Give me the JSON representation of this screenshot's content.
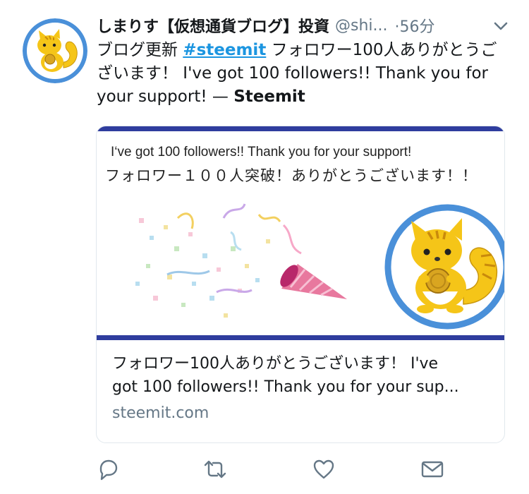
{
  "tweet": {
    "display_name": "しまりす【仮想通貨ブログ】投資",
    "handle": "@shi...",
    "time": "·56分",
    "text_prefix": "ブログ更新 ",
    "hashtag": "#steemit",
    "text_body": " フォロワー100人ありがとうございます！ I've got 100 followers!! Thank you for your support! — ",
    "text_source": "Steemit"
  },
  "card": {
    "image_line1": "I‘ve got 100 followers!! Thank you for your support!",
    "image_line2": "フォロワー１００人突破！ありがとうございます！！",
    "title_line1": "フォロワー100人ありがとうございます！ I've",
    "title_line2": "got 100 followers!! Thank you for your sup...",
    "domain": "steemit.com"
  },
  "actions": {
    "reply_icon": "reply-icon",
    "retweet_icon": "retweet-icon",
    "like_icon": "heart-icon",
    "dm_icon": "envelope-icon"
  },
  "colors": {
    "link": "#1b95e0",
    "secondary": "#657786",
    "card_border": "#e1e8ed",
    "banner_bar": "#2f3d9e",
    "mascot_ring": "#4a90d9",
    "mascot_body": "#f5c518"
  }
}
